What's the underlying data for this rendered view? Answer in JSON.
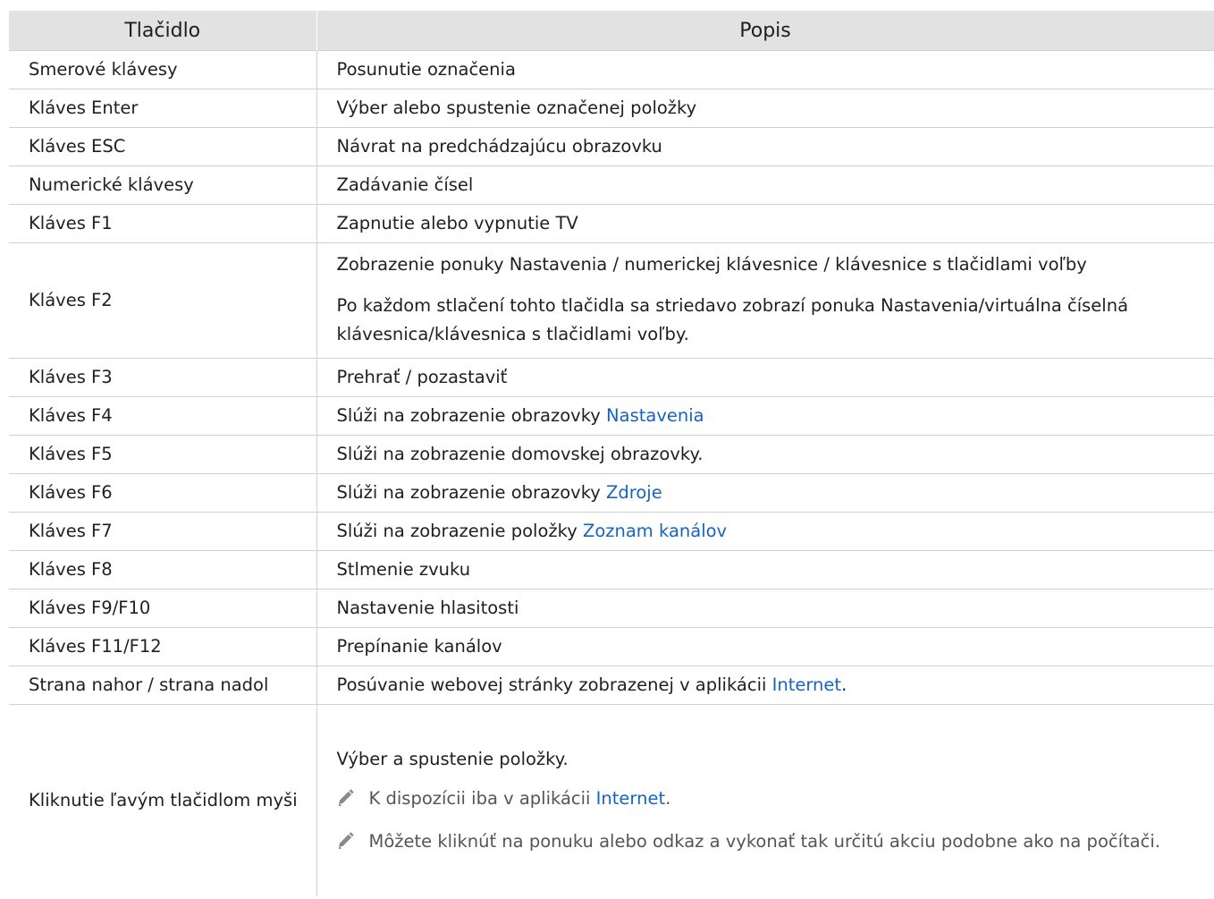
{
  "header": {
    "col1": "Tlačidlo",
    "col2": "Popis"
  },
  "rows": [
    {
      "key": "Smerové klávesy",
      "desc": "Posunutie označenia"
    },
    {
      "key": "Kláves Enter",
      "desc": "Výber alebo spustenie označenej položky"
    },
    {
      "key": "Kláves ESC",
      "desc": "Návrat na predchádzajúcu obrazovku"
    },
    {
      "key": "Numerické klávesy",
      "desc": "Zadávanie čísel"
    },
    {
      "key": "Kláves F1",
      "desc": "Zapnutie alebo vypnutie TV"
    },
    {
      "key": "Kláves F2",
      "desc_p1": "Zobrazenie ponuky Nastavenia / numerickej klávesnice / klávesnice s tlačidlami voľby",
      "desc_p2": "Po každom stlačení tohto tlačidla sa striedavo zobrazí ponuka Nastavenia/virtuálna číselná klávesnica/klávesnica s tlačidlami voľby."
    },
    {
      "key": "Kláves F3",
      "desc": "Prehrať / pozastaviť"
    },
    {
      "key": "Kláves F4",
      "desc": "Slúži na zobrazenie obrazovky ",
      "link": "Nastavenia"
    },
    {
      "key": "Kláves F5",
      "desc": "Slúži na zobrazenie domovskej obrazovky."
    },
    {
      "key": "Kláves F6",
      "desc": "Slúži na zobrazenie obrazovky ",
      "link": "Zdroje"
    },
    {
      "key": "Kláves F7",
      "desc": "Slúži na zobrazenie položky ",
      "link": "Zoznam kanálov"
    },
    {
      "key": "Kláves F8",
      "desc": "Stlmenie zvuku"
    },
    {
      "key": "Kláves F9/F10",
      "desc": "Nastavenie hlasitosti"
    },
    {
      "key": "Kláves F11/F12",
      "desc": "Prepínanie kanálov"
    },
    {
      "key": "Strana nahor / strana nadol",
      "desc": "Posúvanie webovej stránky zobrazenej v aplikácii ",
      "link": "Internet",
      "after": "."
    },
    {
      "key": "Kliknutie ľavým tlačidlom myši",
      "desc": "Výber a spustenie položky.",
      "note1_pre": "K dispozícii iba v aplikácii ",
      "note1_link": "Internet",
      "note1_post": ".",
      "note2": "Môžete kliknúť na ponuku alebo odkaz a vykonať tak určitú akciu podobne ako na počítači.",
      "note_icon": "pencil-icon"
    }
  ],
  "colors": {
    "header_bg": "#e2e2e2",
    "link": "#1565c0",
    "grid": "#d0d0d0",
    "note_text": "#555555"
  }
}
